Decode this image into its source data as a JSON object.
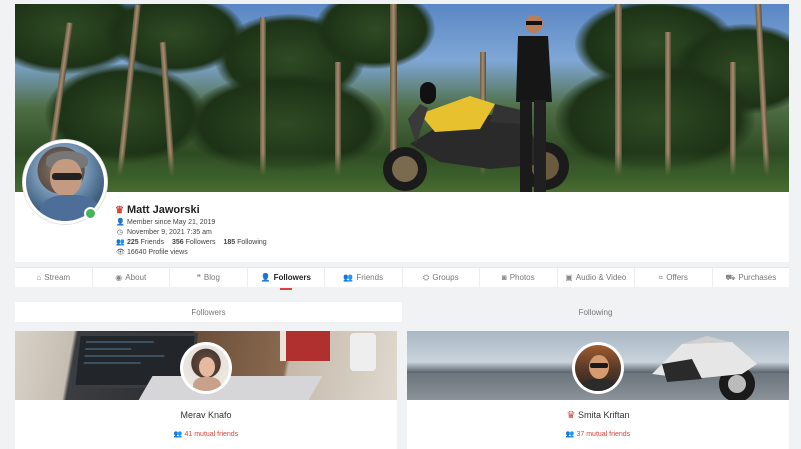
{
  "profile": {
    "name": "Matt Jaworski",
    "member_since": "Member since May 21, 2019",
    "last_seen": "November 9, 2021 7:35 am",
    "friends_count": "225",
    "friends_label": "Friends",
    "followers_count": "356",
    "followers_label": "Followers",
    "following_count": "185",
    "following_label": "Following",
    "profile_views": "16640 Profile views",
    "status_color": "#45b35a"
  },
  "tabs": [
    {
      "label": "Stream",
      "icon": "home-icon"
    },
    {
      "label": "About",
      "icon": "user-circle-icon"
    },
    {
      "label": "Blog",
      "icon": "quote-icon"
    },
    {
      "label": "Followers",
      "icon": "user-check-icon",
      "active": true
    },
    {
      "label": "Friends",
      "icon": "users-icon"
    },
    {
      "label": "Groups",
      "icon": "groups-icon"
    },
    {
      "label": "Photos",
      "icon": "camera-icon"
    },
    {
      "label": "Audio & Video",
      "icon": "video-icon"
    },
    {
      "label": "Offers",
      "icon": "tag-icon"
    },
    {
      "label": "Purchases",
      "icon": "cart-icon"
    }
  ],
  "subtabs": {
    "followers": "Followers",
    "following": "Following"
  },
  "cards": [
    {
      "name": "Merav Knafo",
      "mutual": "41 mutual friends",
      "badge": false
    },
    {
      "name": "Smita Kriftan",
      "mutual": "37 mutual friends",
      "badge": true
    }
  ],
  "colors": {
    "accent": "#d9453a",
    "online": "#45b35a"
  }
}
